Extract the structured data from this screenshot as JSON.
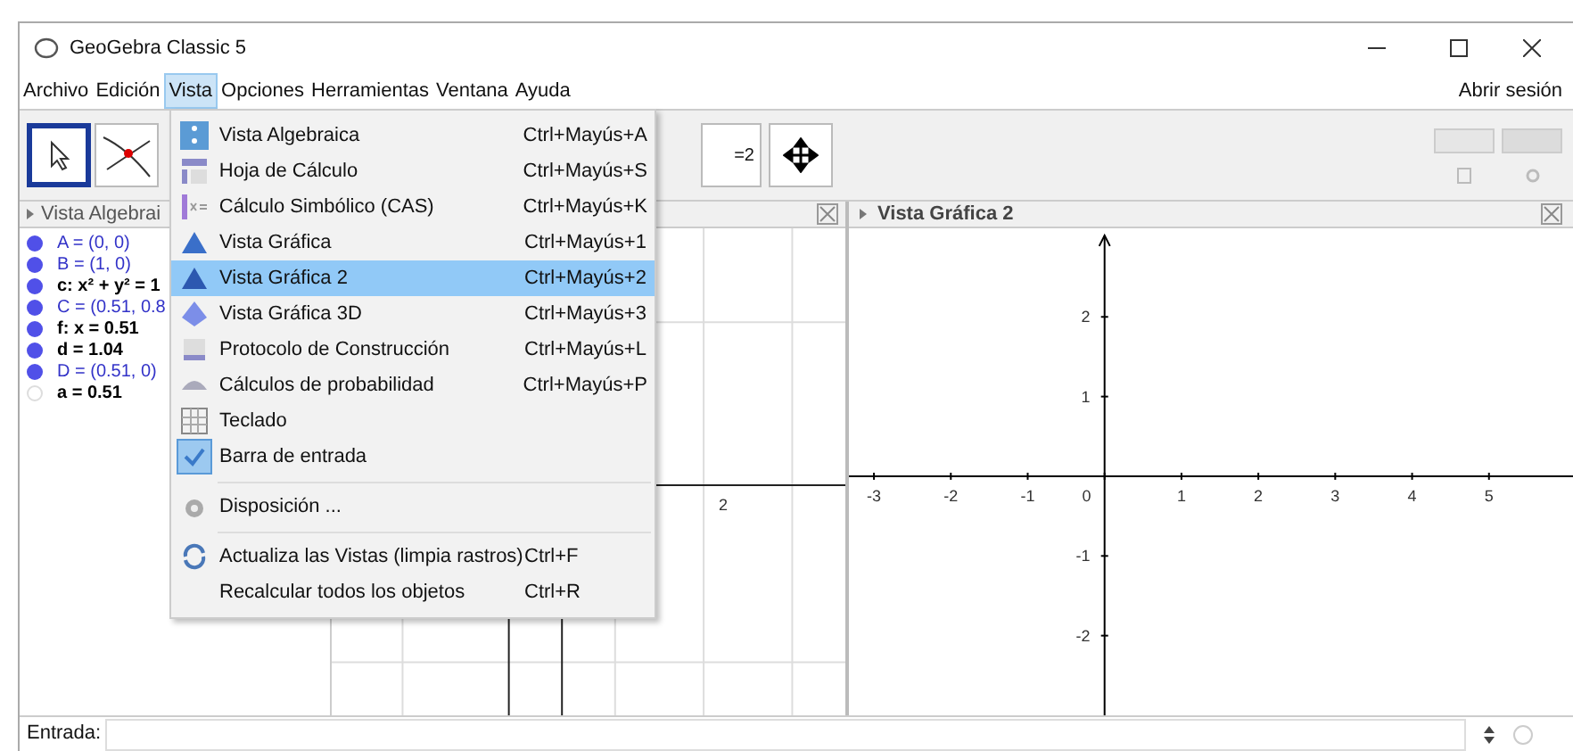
{
  "window": {
    "title": "GeoGebra Classic 5"
  },
  "menu_bar": [
    {
      "label": "Archivo",
      "selected": false
    },
    {
      "label": "Edición",
      "selected": false
    },
    {
      "label": "Vista",
      "selected": true
    },
    {
      "label": "Opciones",
      "selected": false
    },
    {
      "label": "Herramientas",
      "selected": false
    },
    {
      "label": "Ventana",
      "selected": false
    },
    {
      "label": "Ayuda",
      "selected": false
    }
  ],
  "sign_in": "Abrir sesión",
  "toolbar": {
    "tools": [
      {
        "selected": true
      },
      {
        "selected": false
      }
    ],
    "slider_tool_label": "=2"
  },
  "algebra_view": {
    "title": "Vista Algebrai",
    "items": [
      {
        "text": "A = (0, 0)",
        "kind": "free",
        "shown": true
      },
      {
        "text": "B = (1, 0)",
        "kind": "free",
        "shown": true
      },
      {
        "text": "c: x² + y² = 1",
        "kind": "dependent",
        "shown": true
      },
      {
        "text": "C = (0.51, 0.8",
        "kind": "free",
        "shown": true
      },
      {
        "text": "f: x = 0.51",
        "kind": "dependent",
        "shown": true
      },
      {
        "text": "d = 1.04",
        "kind": "dependent",
        "shown": true
      },
      {
        "text": "D = (0.51, 0)",
        "kind": "free",
        "shown": true
      },
      {
        "text": "a = 0.51",
        "kind": "dependent",
        "shown": false
      }
    ]
  },
  "graphics_view": {
    "x_label": "2"
  },
  "graphics_view_2": {
    "title": "Vista Gráfica 2",
    "x_ticks": [
      "-3",
      "-2",
      "-1",
      "0",
      "1",
      "2",
      "3",
      "4",
      "5"
    ],
    "y_ticks": [
      "2",
      "1",
      "-1",
      "-2"
    ]
  },
  "view_menu": [
    {
      "kind": "item",
      "label": "Vista Algebraica",
      "shortcut": "Ctrl+Mayús+A",
      "selected": false,
      "checked": false
    },
    {
      "kind": "item",
      "label": "Hoja de Cálculo",
      "shortcut": "Ctrl+Mayús+S",
      "selected": false,
      "checked": false
    },
    {
      "kind": "item",
      "label": "Cálculo Simbólico (CAS)",
      "shortcut": "Ctrl+Mayús+K",
      "selected": false,
      "checked": false
    },
    {
      "kind": "item",
      "label": "Vista Gráfica",
      "shortcut": "Ctrl+Mayús+1",
      "selected": false,
      "checked": false
    },
    {
      "kind": "item",
      "label": "Vista Gráfica 2",
      "shortcut": "Ctrl+Mayús+2",
      "selected": true,
      "checked": false
    },
    {
      "kind": "item",
      "label": "Vista Gráfica 3D",
      "shortcut": "Ctrl+Mayús+3",
      "selected": false,
      "checked": false
    },
    {
      "kind": "item",
      "label": "Protocolo de Construcción",
      "shortcut": "Ctrl+Mayús+L",
      "selected": false,
      "checked": false
    },
    {
      "kind": "item",
      "label": "Cálculos de probabilidad",
      "shortcut": "Ctrl+Mayús+P",
      "selected": false,
      "checked": false
    },
    {
      "kind": "item",
      "label": "Teclado",
      "selected": false,
      "checked": false
    },
    {
      "kind": "item",
      "label": "Barra de entrada",
      "selected": false,
      "checked": true
    },
    {
      "kind": "separator"
    },
    {
      "kind": "item",
      "label": "Disposición ...",
      "selected": false,
      "checked": false
    },
    {
      "kind": "separator"
    },
    {
      "kind": "item",
      "label": "Actualiza las Vistas (limpia rastros)",
      "shortcut": "Ctrl+F",
      "selected": false,
      "checked": false
    },
    {
      "kind": "item",
      "label": "Recalcular todos los objetos",
      "shortcut": "Ctrl+R",
      "selected": false,
      "checked": false
    }
  ],
  "input_bar": {
    "label": "Entrada:"
  }
}
